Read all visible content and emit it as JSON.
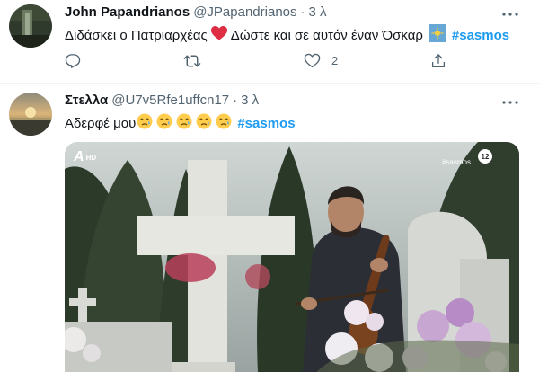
{
  "tweets": [
    {
      "name": "John Papandrianos",
      "handle": "@JPapandrianos",
      "separator": "·",
      "time": "3 λ",
      "text_before_heart": "Διδάσκει ο Πατριαρχέας",
      "text_after_heart": "Δώστε και σε αυτόν έναν Όσκαρ",
      "hashtag": "#sasmos",
      "reply_count": "",
      "retweet_count": "",
      "like_count": "2",
      "icons": [
        "heart-emoji",
        "movie-camera-emoji",
        "reply-icon",
        "retweet-icon",
        "like-icon",
        "share-icon",
        "more-icon"
      ]
    },
    {
      "name": "Στελλα",
      "handle": "@U7v5Rfe1uffcn17",
      "separator": "·",
      "time": "3 λ",
      "text": "Αδερφέ μου",
      "hashtag": "#sasmos",
      "emoji_name": "crying-face-emoji",
      "emoji_count": 5,
      "media": {
        "channel_logo": "A",
        "channel_hd": "HD",
        "show_tag": "#sasmos",
        "rating": "12"
      }
    }
  ],
  "colors": {
    "accent": "#1d9bf0",
    "heart": "#f91880",
    "secondary_text": "#536471",
    "emoji_yellow": "#ffcc4d"
  }
}
